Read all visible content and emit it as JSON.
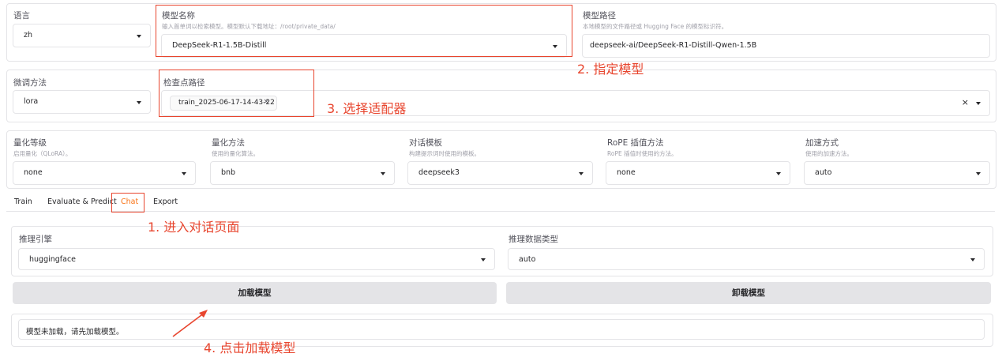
{
  "row1": {
    "language": {
      "label": "语言",
      "value": "zh"
    },
    "model_name": {
      "label": "模型名称",
      "hint": "输入首单词以检索模型。模型默认下载地址：/root/private_data/",
      "value": "DeepSeek-R1-1.5B-Distill"
    },
    "model_path": {
      "label": "模型路径",
      "hint": "本地模型的文件路径或 Hugging Face 的模型标识符。",
      "value": "deepseek-ai/DeepSeek-R1-Distill-Qwen-1.5B"
    }
  },
  "row2": {
    "finetune": {
      "label": "微调方法",
      "value": "lora"
    },
    "checkpoint": {
      "label": "检查点路径",
      "chip": "train_2025-06-17-14-43-22",
      "chip_close": "×",
      "clear": "×"
    }
  },
  "row3": {
    "quant_level": {
      "label": "量化等级",
      "hint": "启用量化（QLoRA）。",
      "value": "none"
    },
    "quant_method": {
      "label": "量化方法",
      "hint": "使用的量化算法。",
      "value": "bnb"
    },
    "template": {
      "label": "对话模板",
      "hint": "构建提示词时使用的模板。",
      "value": "deepseek3"
    },
    "rope": {
      "label": "RoPE 插值方法",
      "hint": "RoPE 插值时使用的方法。",
      "value": "none"
    },
    "accel": {
      "label": "加速方式",
      "hint": "使用的加速方法。",
      "value": "auto"
    }
  },
  "tabs": [
    "Train",
    "Evaluate & Predict",
    "Chat",
    "Export"
  ],
  "active_tab": "Chat",
  "chat": {
    "infer_engine": {
      "label": "推理引擎",
      "value": "huggingface"
    },
    "infer_dtype": {
      "label": "推理数据类型",
      "value": "auto"
    },
    "load_button": "加载模型",
    "unload_button": "卸载模型",
    "status": "模型未加载，请先加载模型。"
  },
  "annotations": {
    "step1": "1. 进入对话页面",
    "step2": "2. 指定模型",
    "step3": "3. 选择适配器",
    "step4": "4. 点击加载模型"
  },
  "colors": {
    "annotation": "#e8452e",
    "active_tab": "#f97316"
  }
}
